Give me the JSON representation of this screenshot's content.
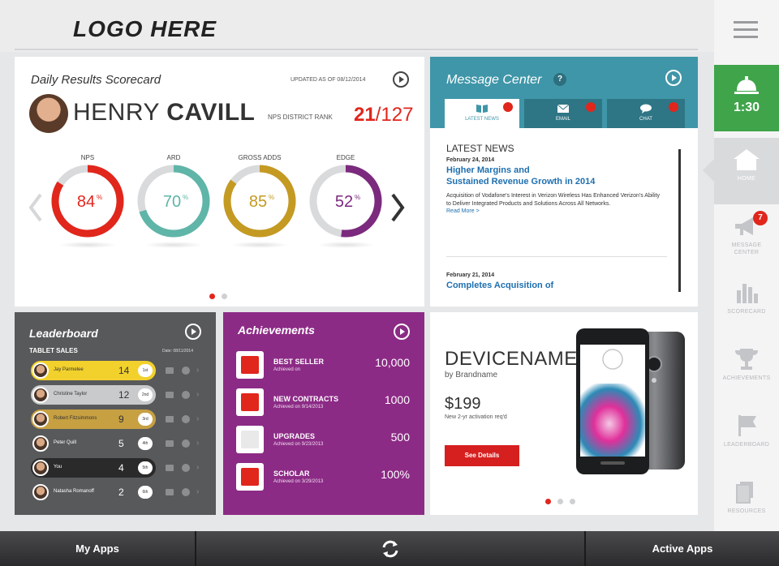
{
  "header": {
    "logo": "LOGO HERE"
  },
  "sidebar": {
    "timer": "1:30",
    "items": [
      {
        "label": "HOME",
        "icon": "home-icon"
      },
      {
        "label": "MESSAGE CENTER",
        "icon": "megaphone-icon",
        "badge": "7"
      },
      {
        "label": "SCORECARD",
        "icon": "bar-chart-icon"
      },
      {
        "label": "ACHIEVEMENTS",
        "icon": "trophy-icon"
      },
      {
        "label": "LEADERBOARD",
        "icon": "flag-icon"
      },
      {
        "label": "RESOURCES",
        "icon": "documents-icon"
      }
    ]
  },
  "scorecard": {
    "title": "Daily Results Scorecard",
    "updated": "UPDATED AS OF 08/12/2014",
    "first_name": "HENRY",
    "last_name": "CAVILL",
    "rank_label": "NPS DISTRICT RANK",
    "rank_value": "21",
    "rank_total": "/127",
    "gauges": [
      {
        "label": "NPS",
        "value": 84,
        "display": "84",
        "unit": "%",
        "color": "#e1261c"
      },
      {
        "label": "ARD",
        "value": 70,
        "display": "70",
        "unit": "%",
        "color": "#5fb5a8"
      },
      {
        "label": "GROSS ADDS",
        "value": 85,
        "display": "85",
        "unit": "%",
        "color": "#c49a22"
      },
      {
        "label": "EDGE",
        "value": 52,
        "display": "52",
        "unit": "%",
        "color": "#7b2a7e"
      }
    ]
  },
  "message_center": {
    "title": "Message Center",
    "help": "?",
    "tabs": [
      {
        "label": "LATEST NEWS"
      },
      {
        "label": "EMAIL"
      },
      {
        "label": "CHAT"
      }
    ],
    "section_title": "LATEST NEWS",
    "news": [
      {
        "date": "February 24, 2014",
        "title_line1": "Higher Margins and",
        "title_line2": "Sustained Revenue Growth in 2014",
        "body": "Acquisition of Vodafone's Interest in Verizon Wireless Has Enhanced Verizon's Ability to Deliver Integrated Products and Solutions Across All Networks.",
        "more": "Read More >"
      },
      {
        "date": "February 21, 2014",
        "title_line1": "Completes Acquisition of"
      }
    ]
  },
  "leaderboard": {
    "title": "Leaderboard",
    "subtitle": "TABLET SALES",
    "date": "Date: 08/11/2014",
    "rows": [
      {
        "name": "Jay Parmelee",
        "value": "14",
        "tag": "1st",
        "color": "#f2d12c"
      },
      {
        "name": "Christine Taylor",
        "value": "12",
        "tag": "2nd",
        "color": "#c9cacc"
      },
      {
        "name": "Robert Fitzsimmons",
        "value": "9",
        "tag": "3rd",
        "color": "#c7a042"
      },
      {
        "name": "Peter Quill",
        "value": "5",
        "tag": "4th",
        "color": "#58595b"
      },
      {
        "name": "You",
        "value": "4",
        "tag": "5th",
        "color": "#2a2a2b"
      },
      {
        "name": "Natasha Romanoff",
        "value": "2",
        "tag": "6th",
        "color": "#58595b"
      }
    ]
  },
  "achievements": {
    "title": "Achievements",
    "items": [
      {
        "name": "BEST SELLER",
        "date": "Achieved on",
        "value": "10,000",
        "icon": "tag-icon"
      },
      {
        "name": "NEW CONTRACTS",
        "date": "Achieved on 9/14/2013",
        "value": "1000",
        "icon": "pen-icon"
      },
      {
        "name": "UPGRADES",
        "date": "Achieved on 9/23/2013",
        "value": "500",
        "icon": "upgrade-icon"
      },
      {
        "name": "SCHOLAR",
        "date": "Achieved on 3/29/2013",
        "value": "100%",
        "icon": "book-icon"
      }
    ]
  },
  "device": {
    "name": "DEVICENAME",
    "brand": "by Brandname",
    "price": "$199",
    "note": "New 2-yr activation req'd",
    "button": "See Details"
  },
  "bottombar": {
    "left": "My Apps",
    "right": "Active Apps",
    "center_icon": "refresh-icon"
  }
}
